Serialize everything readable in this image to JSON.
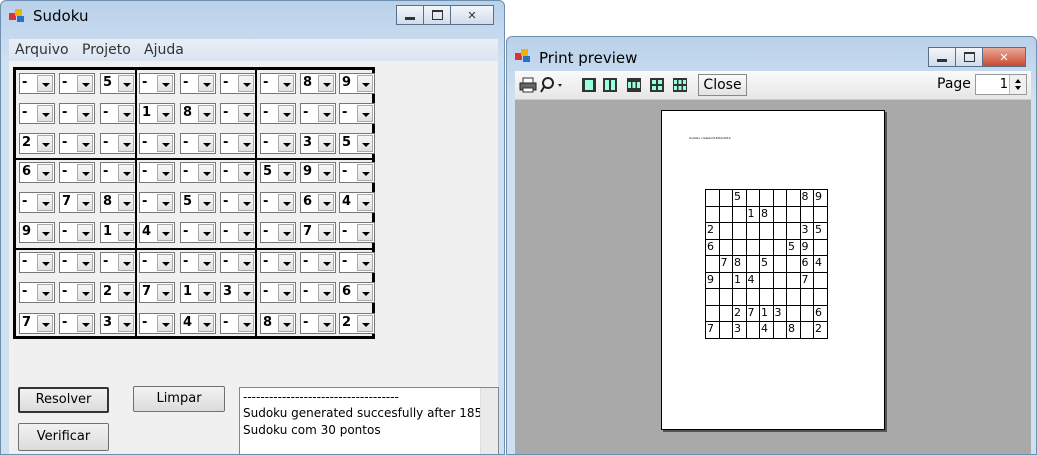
{
  "sudoku_window": {
    "title": "Sudoku",
    "menu": [
      "Arquivo",
      "Projeto",
      "Ajuda"
    ],
    "grid": [
      [
        "-",
        "-",
        "5",
        "-",
        "-",
        "-",
        "-",
        "8",
        "9"
      ],
      [
        "-",
        "-",
        "-",
        "1",
        "8",
        "-",
        "-",
        "-",
        "-"
      ],
      [
        "2",
        "-",
        "-",
        "-",
        "-",
        "-",
        "-",
        "3",
        "5"
      ],
      [
        "6",
        "-",
        "-",
        "-",
        "-",
        "-",
        "5",
        "9",
        "-"
      ],
      [
        "-",
        "7",
        "8",
        "-",
        "5",
        "-",
        "-",
        "6",
        "4"
      ],
      [
        "9",
        "-",
        "1",
        "4",
        "-",
        "-",
        "-",
        "7",
        "-"
      ],
      [
        "-",
        "-",
        "-",
        "-",
        "-",
        "-",
        "-",
        "-",
        "-"
      ],
      [
        "-",
        "-",
        "2",
        "7",
        "1",
        "3",
        "-",
        "-",
        "6"
      ],
      [
        "7",
        "-",
        "3",
        "-",
        "4",
        "-",
        "8",
        "-",
        "2"
      ]
    ],
    "buttons": {
      "resolver": "Resolver",
      "limpar": "Limpar",
      "verificar": "Verificar"
    },
    "log_lines": [
      "------------------------------------",
      "Sudoku generated succesfully after 185",
      "Sudoku com 30 pontos"
    ]
  },
  "preview_window": {
    "title": "Print preview",
    "toolbar": {
      "close_label": "Close",
      "page_label": "Page",
      "page_value": "1",
      "icons": [
        "printer-icon",
        "zoom-icon",
        "one-page-icon",
        "two-pages-icon",
        "three-pages-icon",
        "four-pages-icon",
        "six-pages-icon"
      ]
    },
    "page_header": "Sudoku created 03/02/2012",
    "grid": [
      [
        "",
        "",
        "5",
        "",
        "",
        "",
        "",
        "8",
        "9"
      ],
      [
        "",
        "",
        "",
        "1",
        "8",
        "",
        "",
        "",
        ""
      ],
      [
        "2",
        "",
        "",
        "",
        "",
        "",
        "",
        "3",
        "5"
      ],
      [
        "6",
        "",
        "",
        "",
        "",
        "",
        "5",
        "9",
        ""
      ],
      [
        "",
        "7",
        "8",
        "",
        "5",
        "",
        "",
        "6",
        "4"
      ],
      [
        "9",
        "",
        "1",
        "4",
        "",
        "",
        "",
        "7",
        ""
      ],
      [
        "",
        "",
        "",
        "",
        "",
        "",
        "",
        "",
        ""
      ],
      [
        "",
        "",
        "2",
        "7",
        "1",
        "3",
        "",
        "",
        "6"
      ],
      [
        "7",
        "",
        "3",
        "",
        "4",
        "",
        "8",
        "",
        "2"
      ]
    ]
  }
}
